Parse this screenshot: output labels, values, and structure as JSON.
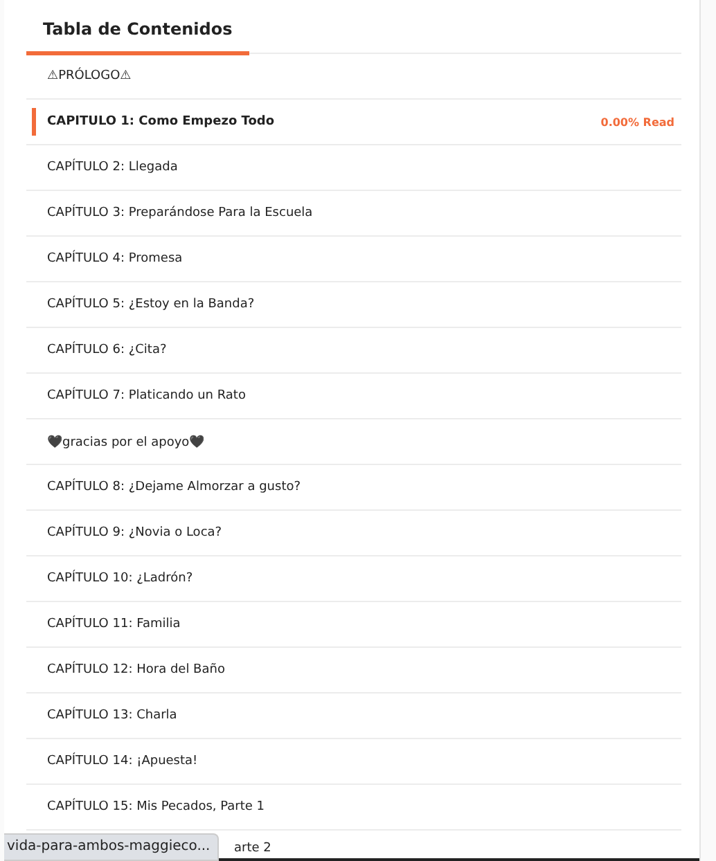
{
  "title": "Tabla de Contenidos",
  "chapters": [
    {
      "title": "⚠PRÓLOGO⚠",
      "selected": false
    },
    {
      "title": "CAPITULO 1: Como Empezo Todo",
      "selected": true,
      "progress": "0.00% Read"
    },
    {
      "title": "CAPÍTULO 2: Llegada",
      "selected": false
    },
    {
      "title": "CAPÍTULO 3: Preparándose Para la Escuela",
      "selected": false
    },
    {
      "title": "CAPÍTULO 4: Promesa",
      "selected": false
    },
    {
      "title": "CAPÍTULO 5: ¿Estoy en la Banda?",
      "selected": false
    },
    {
      "title": "CAPÍTULO 6: ¿Cita?",
      "selected": false
    },
    {
      "title": "CAPÍTULO 7: Platicando un Rato",
      "selected": false
    },
    {
      "title": "🖤gracias por el apoyo🖤",
      "selected": false
    },
    {
      "title": "CAPÍTULO 8: ¿Dejame Almorzar a gusto?",
      "selected": false
    },
    {
      "title": "CAPÍTULO 9: ¿Novia o Loca?",
      "selected": false
    },
    {
      "title": "CAPÍTULO 10: ¿Ladrón?",
      "selected": false
    },
    {
      "title": "CAPÍTULO 11: Familia",
      "selected": false
    },
    {
      "title": "CAPÍTULO 12: Hora del Baño",
      "selected": false
    },
    {
      "title": "CAPÍTULO 13: Charla",
      "selected": false
    },
    {
      "title": "CAPÍTULO 14: ¡Apuesta!",
      "selected": false
    },
    {
      "title": "CAPÍTULO 15: Mis Pecados, Parte 1",
      "selected": false
    },
    {
      "title": "arte 2",
      "selected": false,
      "kind": "covered"
    }
  ],
  "status_tooltip": "vida-para-ambos-maggieco..."
}
